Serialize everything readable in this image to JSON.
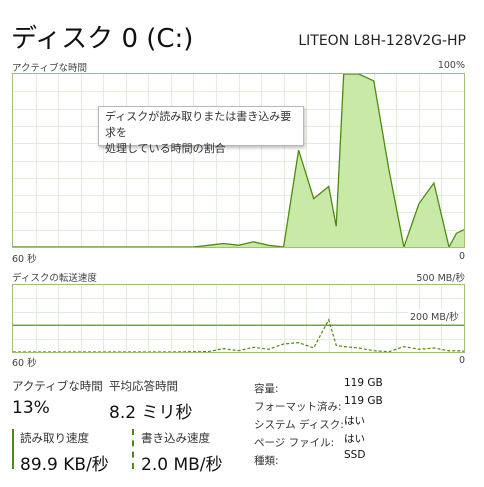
{
  "header": {
    "title": "ディスク 0 (C:)",
    "model": "LITEON L8H-128V2G-HP"
  },
  "active_time_graph": {
    "label": "アクティブな時間",
    "max_label": "100%",
    "x_start_label": "60 秒",
    "x_end_label": "0",
    "tooltip_line1": "ディスクが読み取りまたは書き込み要求を",
    "tooltip_line2": "処理している時間の割合",
    "color": "#4f8a10",
    "fill": "#c9eaa6"
  },
  "transfer_graph": {
    "label": "ディスクの転送速度",
    "max_label": "500 MB/秒",
    "ref_label": "200 MB/秒",
    "x_start_label": "60 秒",
    "x_end_label": "0"
  },
  "stats": {
    "active_time_label": "アクティブな時間",
    "active_time_value": "13%",
    "avg_response_label": "平均応答時間",
    "avg_response_value": "8.2 ミリ秒",
    "read_speed_label": "読み取り速度",
    "read_speed_value": "89.9 KB/秒",
    "write_speed_label": "書き込み速度",
    "write_speed_value": "2.0 MB/秒"
  },
  "properties": [
    {
      "label": "容量:",
      "value": "119 GB"
    },
    {
      "label": "フォーマット済み:",
      "value": "119 GB"
    },
    {
      "label": "システム ディスク:",
      "value": "はい"
    },
    {
      "label": "ページ ファイル:",
      "value": "はい"
    },
    {
      "label": "種類:",
      "value": "SSD"
    }
  ],
  "chart_data": [
    {
      "type": "area",
      "title": "アクティブな時間",
      "xlabel": "",
      "ylabel": "",
      "x_unit": "seconds ago",
      "ylim": [
        0,
        100
      ],
      "x": [
        60,
        58,
        56,
        54,
        52,
        50,
        48,
        46,
        44,
        42,
        40,
        38,
        36,
        34,
        32,
        30,
        28,
        26,
        24,
        22,
        20,
        18,
        17,
        16,
        14,
        12,
        10,
        8,
        6,
        4,
        2,
        1,
        0
      ],
      "values": [
        0,
        0,
        0,
        0,
        0,
        0,
        0,
        0,
        0,
        0,
        0,
        0,
        0,
        1,
        2,
        1,
        3,
        1,
        0,
        56,
        28,
        35,
        12,
        100,
        100,
        96,
        45,
        0,
        25,
        37,
        0,
        8,
        10
      ],
      "grid": true
    },
    {
      "type": "line",
      "title": "ディスクの転送速度",
      "ylim": [
        0,
        500
      ],
      "x_unit": "seconds ago",
      "reference_line": 200,
      "series": [
        {
          "name": "",
          "style": "solid",
          "values": []
        },
        {
          "name": "",
          "style": "dashed",
          "x": [
            60,
            50,
            40,
            34,
            32,
            30,
            28,
            26,
            24,
            22,
            20,
            18,
            17,
            16,
            14,
            12,
            10,
            8,
            6,
            4,
            2,
            1,
            0
          ],
          "values": [
            0,
            0,
            0,
            3,
            25,
            10,
            35,
            20,
            60,
            70,
            30,
            240,
            50,
            40,
            30,
            10,
            2,
            40,
            20,
            30,
            8,
            10,
            5
          ]
        }
      ],
      "grid": true
    }
  ]
}
